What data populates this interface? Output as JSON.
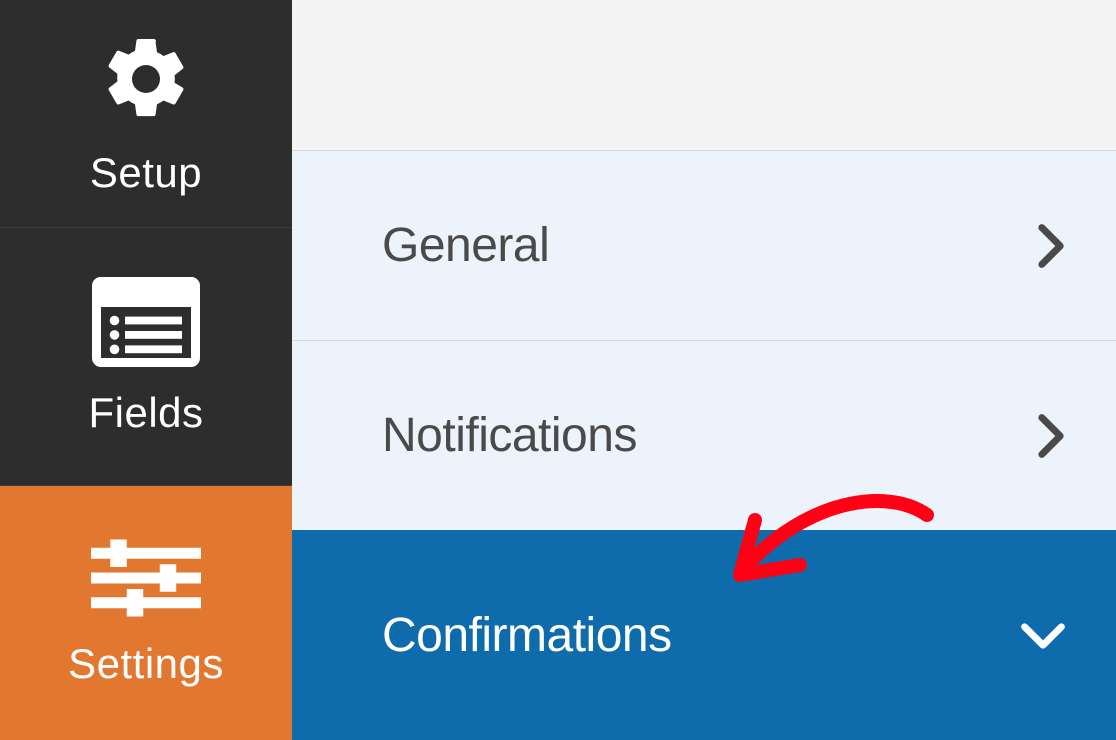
{
  "sidebar": {
    "items": [
      {
        "label": "Setup",
        "icon": "gear-icon",
        "active": false
      },
      {
        "label": "Fields",
        "icon": "fields-icon",
        "active": false
      },
      {
        "label": "Settings",
        "icon": "sliders-icon",
        "active": true
      }
    ]
  },
  "settings_panel": {
    "rows": [
      {
        "label": "General",
        "expanded": false
      },
      {
        "label": "Notifications",
        "expanded": false
      },
      {
        "label": "Confirmations",
        "expanded": true
      }
    ]
  },
  "colors": {
    "sidebar_bg": "#2d2d2d",
    "accent_orange": "#e27730",
    "row_bg": "#ecf3fa",
    "row_active_bg": "#0e6cad",
    "text_dark": "#4a4a4a",
    "annotation_red": "#ff0015"
  }
}
